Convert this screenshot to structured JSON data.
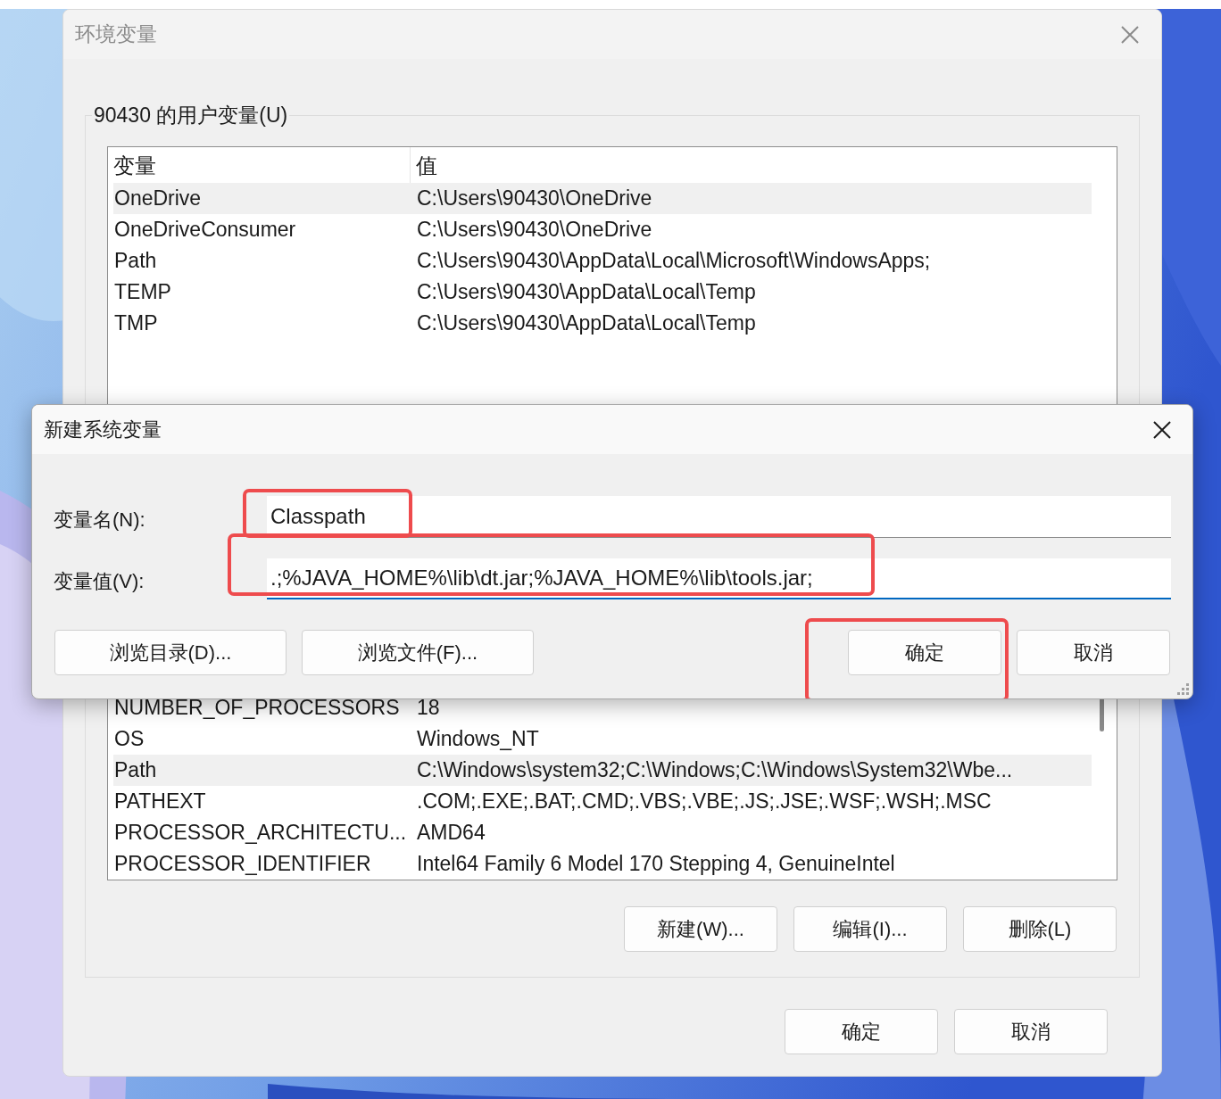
{
  "window": {
    "title": "环境变量",
    "active": false
  },
  "user_variables": {
    "label": "90430 的用户变量(U)",
    "columns": [
      "变量",
      "值"
    ],
    "rows": [
      {
        "name": "OneDrive",
        "value": "C:\\Users\\90430\\OneDrive",
        "selected": true
      },
      {
        "name": "OneDriveConsumer",
        "value": "C:\\Users\\90430\\OneDrive",
        "selected": false
      },
      {
        "name": "Path",
        "value": "C:\\Users\\90430\\AppData\\Local\\Microsoft\\WindowsApps;",
        "selected": false
      },
      {
        "name": "TEMP",
        "value": "C:\\Users\\90430\\AppData\\Local\\Temp",
        "selected": false
      },
      {
        "name": "TMP",
        "value": "C:\\Users\\90430\\AppData\\Local\\Temp",
        "selected": false
      }
    ]
  },
  "system_variables": {
    "rows": [
      {
        "name": "NUMBER_OF_PROCESSORS",
        "value": "18",
        "selected": false
      },
      {
        "name": "OS",
        "value": "Windows_NT",
        "selected": false
      },
      {
        "name": "Path",
        "value": "C:\\Windows\\system32;C:\\Windows;C:\\Windows\\System32\\Wbe...",
        "selected": true
      },
      {
        "name": "PATHEXT",
        "value": ".COM;.EXE;.BAT;.CMD;.VBS;.VBE;.JS;.JSE;.WSF;.WSH;.MSC",
        "selected": false
      },
      {
        "name": "PROCESSOR_ARCHITECTU...",
        "value": "AMD64",
        "selected": false
      },
      {
        "name": "PROCESSOR_IDENTIFIER",
        "value": "Intel64 Family 6 Model 170 Stepping 4, GenuineIntel",
        "selected": false
      }
    ],
    "buttons": [
      "新建(W)...",
      "编辑(I)...",
      "删除(L)"
    ]
  },
  "footer_buttons": [
    "确定",
    "取消"
  ],
  "dialog": {
    "title": "新建系统变量",
    "fields": [
      {
        "label": "变量名(N):",
        "value": "Classpath",
        "focused": false,
        "highlighted": true
      },
      {
        "label": "变量值(V):",
        "value": ".;%JAVA_HOME%\\lib\\dt.jar;%JAVA_HOME%\\lib\\tools.jar;",
        "focused": true,
        "highlighted": true
      }
    ],
    "buttons": [
      {
        "label": "浏览目录(D)...",
        "kind": "browse",
        "highlighted": false
      },
      {
        "label": "浏览文件(F)...",
        "kind": "browse",
        "highlighted": false
      },
      {
        "label": "确定",
        "kind": "action",
        "highlighted": true
      },
      {
        "label": "取消",
        "kind": "action",
        "highlighted": false
      }
    ]
  }
}
